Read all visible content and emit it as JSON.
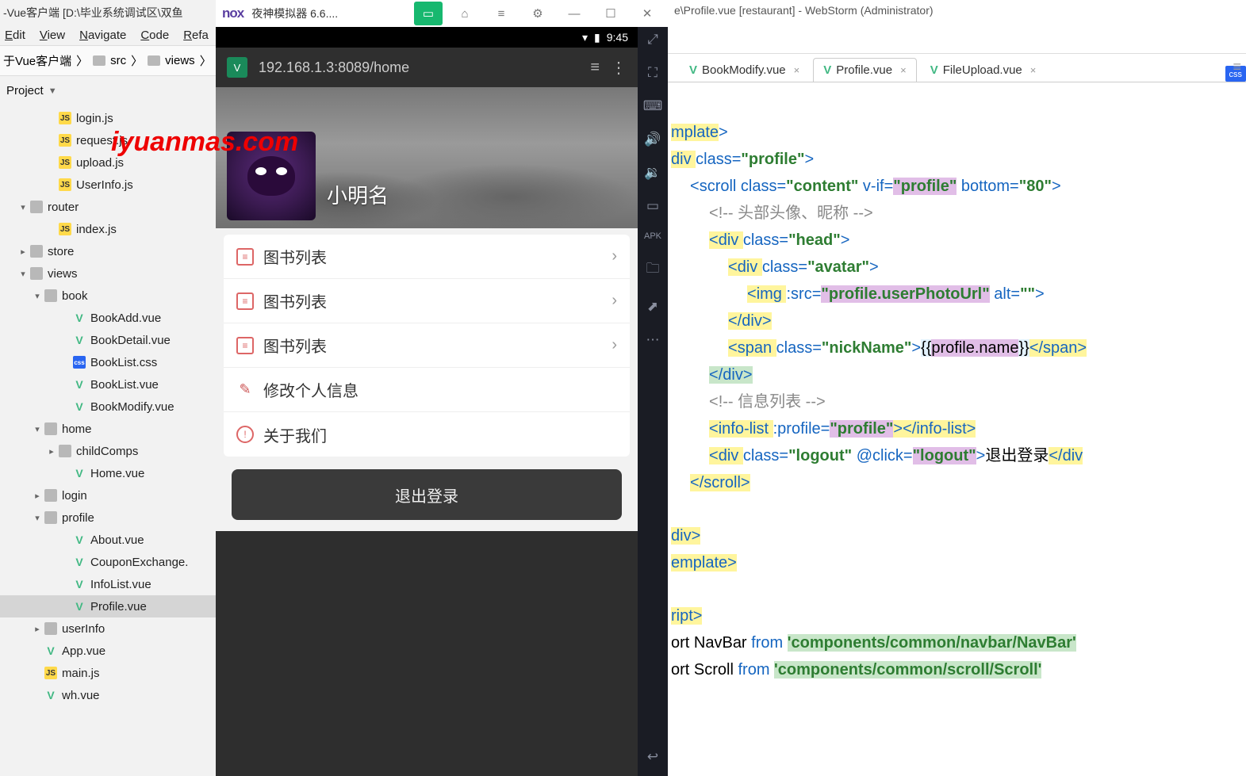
{
  "watermark": "iyuanmas.com",
  "ws": {
    "title": "-Vue客户端 [D:\\毕业系统调试区\\双鱼",
    "menu": [
      "dit",
      "View",
      "Navigate",
      "Code",
      "Refa"
    ],
    "crumbs": [
      "于Vue客户端",
      "src",
      "views"
    ],
    "project": "Project",
    "tree": [
      {
        "d": 3,
        "t": "js",
        "n": "login.js"
      },
      {
        "d": 3,
        "t": "js",
        "n": "request.js"
      },
      {
        "d": 3,
        "t": "js",
        "n": "upload.js"
      },
      {
        "d": 3,
        "t": "js",
        "n": "UserInfo.js"
      },
      {
        "d": 1,
        "t": "fo",
        "n": "router",
        "c": "v"
      },
      {
        "d": 3,
        "t": "js",
        "n": "index.js"
      },
      {
        "d": 1,
        "t": "fo",
        "n": "store",
        "c": ">"
      },
      {
        "d": 1,
        "t": "fo",
        "n": "views",
        "c": "v"
      },
      {
        "d": 2,
        "t": "fo",
        "n": "book",
        "c": "v"
      },
      {
        "d": 4,
        "t": "vu",
        "n": "BookAdd.vue"
      },
      {
        "d": 4,
        "t": "vu",
        "n": "BookDetail.vue"
      },
      {
        "d": 4,
        "t": "css",
        "n": "BookList.css"
      },
      {
        "d": 4,
        "t": "vu",
        "n": "BookList.vue"
      },
      {
        "d": 4,
        "t": "vu",
        "n": "BookModify.vue"
      },
      {
        "d": 2,
        "t": "fo",
        "n": "home",
        "c": "v"
      },
      {
        "d": 3,
        "t": "fo",
        "n": "childComps",
        "c": ">"
      },
      {
        "d": 4,
        "t": "vu",
        "n": "Home.vue"
      },
      {
        "d": 2,
        "t": "fo",
        "n": "login",
        "c": ">"
      },
      {
        "d": 2,
        "t": "fo",
        "n": "profile",
        "c": "v"
      },
      {
        "d": 4,
        "t": "vu",
        "n": "About.vue"
      },
      {
        "d": 4,
        "t": "vu",
        "n": "CouponExchange."
      },
      {
        "d": 4,
        "t": "vu",
        "n": "InfoList.vue"
      },
      {
        "d": 4,
        "t": "vu",
        "n": "Profile.vue",
        "sel": true
      },
      {
        "d": 2,
        "t": "fo",
        "n": "userInfo",
        "c": ">"
      },
      {
        "d": 2,
        "t": "vu",
        "n": "App.vue"
      },
      {
        "d": 2,
        "t": "js",
        "n": "main.js"
      },
      {
        "d": 2,
        "t": "vu",
        "n": "wh.vue"
      }
    ]
  },
  "nox": {
    "logo": "nox",
    "title": "夜神模拟器 6.6....",
    "time": "9:45",
    "url": "192.168.1.3:8089/home",
    "nick": "小明名",
    "items": [
      {
        "icon": "list",
        "label": "图书列表",
        "arrow": true
      },
      {
        "icon": "list",
        "label": "图书列表",
        "arrow": true
      },
      {
        "icon": "list",
        "label": "图书列表",
        "arrow": true
      },
      {
        "icon": "pen",
        "label": "修改个人信息",
        "arrow": false
      },
      {
        "icon": "info",
        "label": "关于我们",
        "arrow": false
      }
    ],
    "logout": "退出登录"
  },
  "right": {
    "title": "e\\Profile.vue [restaurant] - WebStorm (Administrator)",
    "tabs": [
      {
        "label": "BookModify.vue"
      },
      {
        "label": "Profile.vue",
        "active": true
      },
      {
        "label": "FileUpload.vue"
      }
    ],
    "code": {
      "l1a": "mplate",
      "l1b": ">",
      "l2a": "div ",
      "l2b": "class=",
      "l2c": "\"profile\"",
      "l2d": ">",
      "l3a": "<scroll ",
      "l3b": "class=",
      "l3c": "\"content\"",
      "l3d": " v-if=",
      "l3e": "\"profile\"",
      "l3f": " bottom=",
      "l3g": "\"80\"",
      "l3h": ">",
      "l4": "<!-- 头部头像、昵称 -->",
      "l5a": "<div ",
      "l5b": "class=",
      "l5c": "\"head\"",
      "l5d": ">",
      "l6a": "<div ",
      "l6b": "class=",
      "l6c": "\"avatar\"",
      "l6d": ">",
      "l7a": "<img ",
      "l7b": ":src=",
      "l7c": "\"profile.userPhotoUrl\"",
      "l7d": " alt=",
      "l7e": "\"\"",
      "l7f": ">",
      "l8": "</div>",
      "l9a": "<span ",
      "l9b": "class=",
      "l9c": "\"nickName\"",
      "l9d": ">",
      "l9e": "{{",
      "l9f": "profile.name",
      "l9g": "}}",
      "l9h": "</span>",
      "l10": "</div>",
      "l11": "<!-- 信息列表 -->",
      "l12a": "<info-list ",
      "l12b": ":profile=",
      "l12c": "\"profile\"",
      "l12d": "></info-list>",
      "l13a": "<div ",
      "l13b": "class=",
      "l13c": "\"logout\"",
      "l13d": " @click=",
      "l13e": "\"logout\"",
      "l13f": ">",
      "l13g": "退出登录",
      "l13h": "</div",
      "l14": "</scroll>",
      "l15": "div>",
      "l16": "emplate>",
      "l17": "ript>",
      "l18a": "ort ",
      "l18b": "NavBar ",
      "l18c": "from ",
      "l18d": "'components/common/navbar/NavBar'",
      "l19a": "ort ",
      "l19b": "Scroll ",
      "l19c": "from ",
      "l19d": "'components/common/scroll/Scroll'"
    }
  }
}
